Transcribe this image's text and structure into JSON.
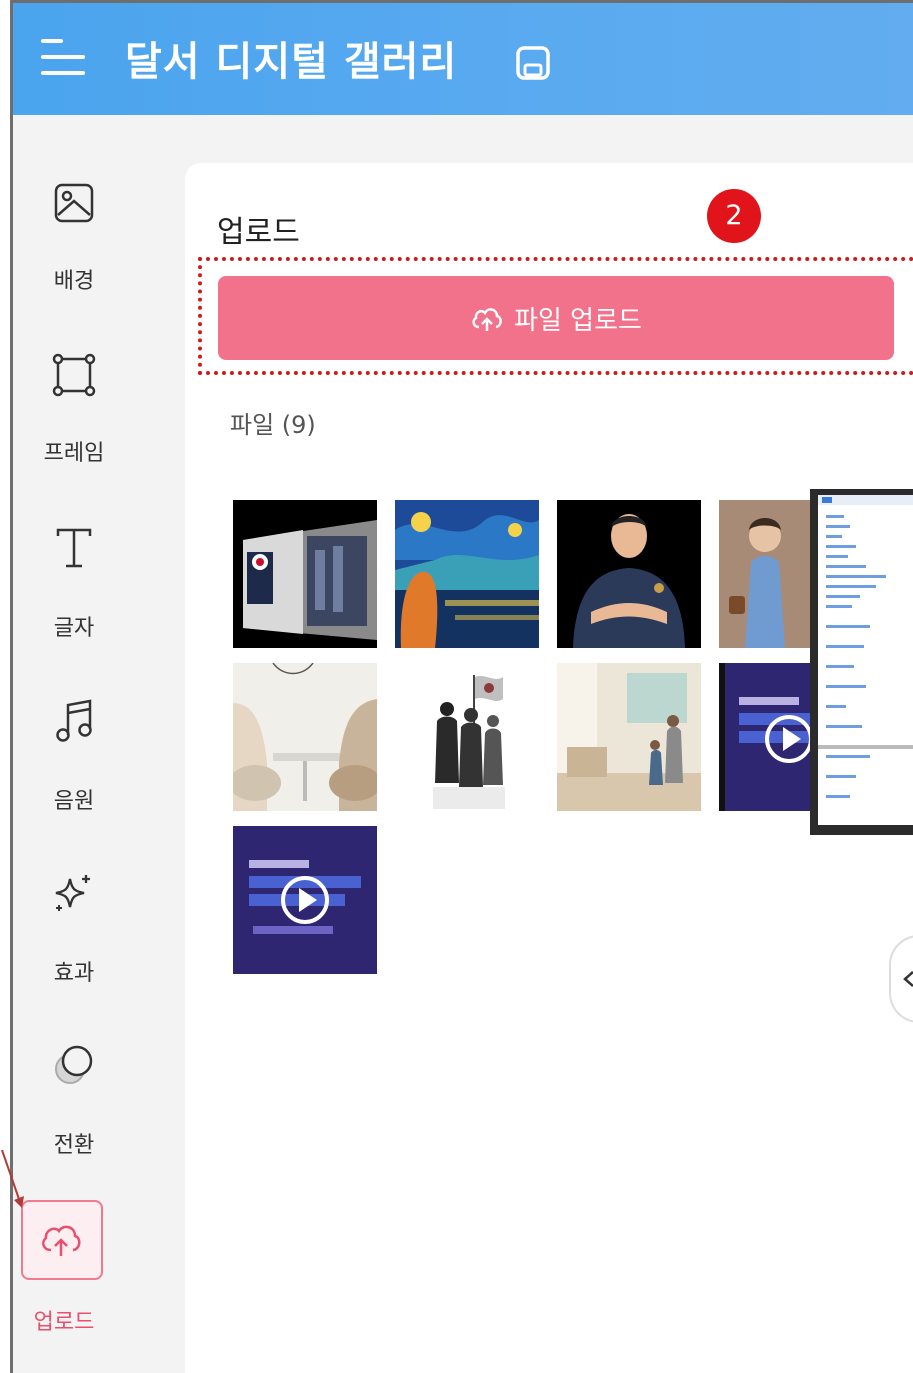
{
  "header": {
    "title": "달서 디지털 갤러리"
  },
  "sidebar": {
    "items": [
      {
        "label": "배경",
        "icon": "image-icon"
      },
      {
        "label": "프레임",
        "icon": "frame-icon"
      },
      {
        "label": "글자",
        "icon": "text-icon"
      },
      {
        "label": "음원",
        "icon": "music-icon"
      },
      {
        "label": "효과",
        "icon": "sparkle-icon"
      },
      {
        "label": "전환",
        "icon": "transition-icon"
      },
      {
        "label": "업로드",
        "icon": "cloud-upload-icon",
        "active": true
      }
    ]
  },
  "panel": {
    "title": "업로드",
    "step_badge": "2",
    "upload_button": "파일 업로드",
    "file_count": "파일 (9)",
    "thumbnails": [
      {
        "kind": "image",
        "subject": "building-with-flag"
      },
      {
        "kind": "image",
        "subject": "starry-night-cat"
      },
      {
        "kind": "image",
        "subject": "man-arms-crossed"
      },
      {
        "kind": "image",
        "subject": "child-portrait"
      },
      {
        "kind": "image",
        "subject": "people-at-table"
      },
      {
        "kind": "image",
        "subject": "soldier-silhouettes"
      },
      {
        "kind": "image",
        "subject": "family-in-room"
      },
      {
        "kind": "video",
        "subject": "purple-slide-video"
      },
      {
        "kind": "video",
        "subject": "purple-slide-video"
      }
    ]
  },
  "colors": {
    "header": "#4aa4ee",
    "accent": "#f2728b",
    "badge": "#e0141a"
  }
}
